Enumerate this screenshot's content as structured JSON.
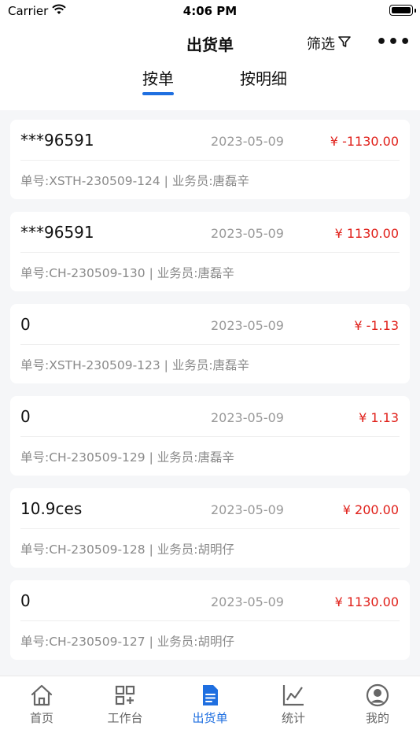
{
  "status_bar": {
    "carrier": "Carrier",
    "time": "4:06 PM"
  },
  "header": {
    "title": "出货单",
    "filter_label": "筛选",
    "more_label": "•••"
  },
  "tabs": [
    {
      "label": "按单",
      "active": true
    },
    {
      "label": "按明细",
      "active": false
    }
  ],
  "orders": [
    {
      "customer": "***96591",
      "date": "2023-05-09",
      "amount": "¥ -1130.00",
      "meta": "单号:XSTH-230509-124 | 业务员:唐磊辛"
    },
    {
      "customer": "***96591",
      "date": "2023-05-09",
      "amount": "¥ 1130.00",
      "meta": "单号:CH-230509-130 | 业务员:唐磊辛"
    },
    {
      "customer": "0",
      "date": "2023-05-09",
      "amount": "¥ -1.13",
      "meta": "单号:XSTH-230509-123 | 业务员:唐磊辛"
    },
    {
      "customer": "0",
      "date": "2023-05-09",
      "amount": "¥ 1.13",
      "meta": "单号:CH-230509-129 | 业务员:唐磊辛"
    },
    {
      "customer": "10.9ces",
      "date": "2023-05-09",
      "amount": "¥ 200.00",
      "meta": "单号:CH-230509-128 | 业务员:胡明仔"
    },
    {
      "customer": "0",
      "date": "2023-05-09",
      "amount": "¥ 1130.00",
      "meta": "单号:CH-230509-127 | 业务员:胡明仔"
    }
  ],
  "tabbar": [
    {
      "label": "首页",
      "icon": "home-icon",
      "active": false
    },
    {
      "label": "工作台",
      "icon": "workbench-grid-icon",
      "active": false
    },
    {
      "label": "出货单",
      "icon": "document-icon",
      "active": true
    },
    {
      "label": "统计",
      "icon": "chart-icon",
      "active": false
    },
    {
      "label": "我的",
      "icon": "user-profile-icon",
      "active": false
    }
  ],
  "colors": {
    "accent": "#1f6fe0",
    "amount": "#e0201a",
    "secondary_text": "#999999",
    "page_background": "#f5f6f8"
  }
}
